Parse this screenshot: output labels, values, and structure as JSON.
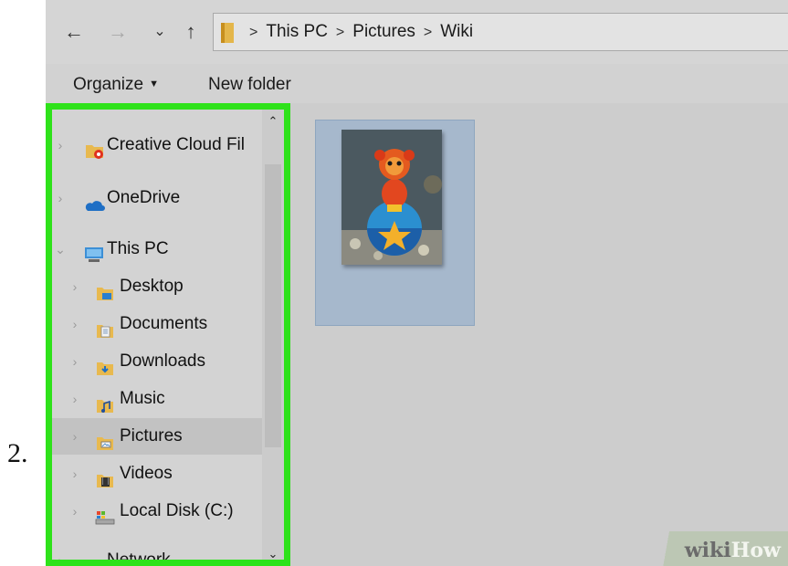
{
  "step_number": "2.",
  "address_bar": {
    "nav": {
      "back": "←",
      "forward": "→",
      "recent": "⌄",
      "up": "↑"
    },
    "breadcrumbs": [
      "This PC",
      "Pictures",
      "Wiki"
    ],
    "separator": ">"
  },
  "toolbar": {
    "organize": "Organize",
    "new_folder": "New folder"
  },
  "nav_pane": {
    "items": [
      {
        "label": "Creative Cloud Fil",
        "icon": "creative-cloud-folder-icon",
        "expanded": false
      },
      {
        "label": "OneDrive",
        "icon": "onedrive-cloud-icon",
        "expanded": false
      },
      {
        "label": "This PC",
        "icon": "computer-icon",
        "expanded": true
      },
      {
        "label": "Desktop",
        "icon": "desktop-folder-icon",
        "expanded": false
      },
      {
        "label": "Documents",
        "icon": "documents-folder-icon",
        "expanded": false
      },
      {
        "label": "Downloads",
        "icon": "downloads-folder-icon",
        "expanded": false
      },
      {
        "label": "Music",
        "icon": "music-folder-icon",
        "expanded": false
      },
      {
        "label": "Pictures",
        "icon": "pictures-folder-icon",
        "expanded": false,
        "selected": true
      },
      {
        "label": "Videos",
        "icon": "videos-folder-icon",
        "expanded": false
      },
      {
        "label": "Local Disk (C:)",
        "icon": "local-disk-icon",
        "expanded": false
      },
      {
        "label": "Network",
        "icon": "network-icon",
        "expanded": false
      }
    ],
    "highlight_color": "#2ee21a"
  },
  "content": {
    "file_selected": true,
    "thumbnail_icon": "toy-figure-photo-thumbnail"
  },
  "watermark": {
    "part1": "wiki",
    "part2": "How"
  }
}
